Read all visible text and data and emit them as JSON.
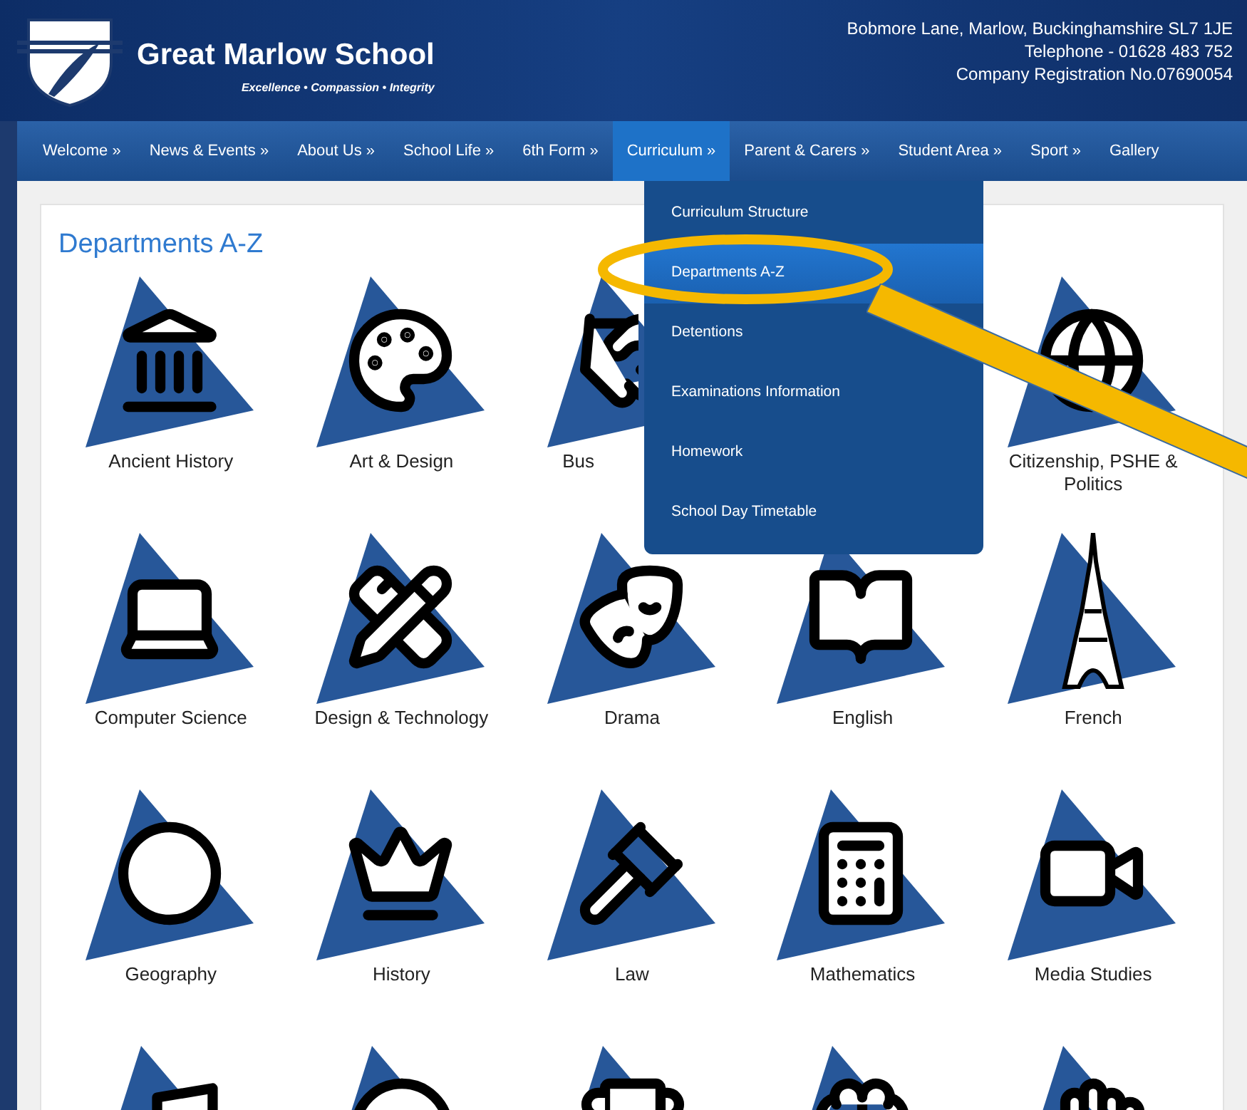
{
  "header": {
    "school_name": "Great Marlow School",
    "tagline": "Excellence • Compassion • Integrity",
    "address": "Bobmore Lane, Marlow, Buckinghamshire SL7 1JE",
    "telephone": "Telephone - 01628 483 752",
    "registration": "Company Registration No.07690054"
  },
  "nav": [
    {
      "label": "Welcome »",
      "selected": false
    },
    {
      "label": "News & Events »",
      "selected": false
    },
    {
      "label": "About Us »",
      "selected": false
    },
    {
      "label": "School Life »",
      "selected": false
    },
    {
      "label": "6th Form »",
      "selected": false
    },
    {
      "label": "Curriculum »",
      "selected": true
    },
    {
      "label": "Parent & Carers »",
      "selected": false
    },
    {
      "label": "Student Area »",
      "selected": false
    },
    {
      "label": "Sport »",
      "selected": false
    },
    {
      "label": "Gallery",
      "selected": false
    }
  ],
  "dropdown": [
    {
      "label": "Curriculum Structure",
      "selected": false
    },
    {
      "label": "Departments A-Z",
      "selected": true
    },
    {
      "label": "Detentions",
      "selected": false
    },
    {
      "label": "Examinations Information",
      "selected": false
    },
    {
      "label": "Homework",
      "selected": false
    },
    {
      "label": "School Day Timetable",
      "selected": false
    }
  ],
  "page_title": "Departments A-Z",
  "departments": [
    {
      "kind": "full",
      "label": "Ancient History"
    },
    {
      "kind": "full",
      "label": "Art & Design"
    },
    {
      "kind": "covered",
      "label": "Bus"
    },
    {
      "kind": "hidden"
    },
    {
      "kind": "full",
      "label": "Citizenship, PSHE & Politics"
    },
    {
      "kind": "full",
      "label": "Computer Science"
    },
    {
      "kind": "full",
      "label": "Design & Technology"
    },
    {
      "kind": "full",
      "label": "Drama"
    },
    {
      "kind": "full",
      "label": "English"
    },
    {
      "kind": "full",
      "label": "French"
    },
    {
      "kind": "full",
      "label": "Geography"
    },
    {
      "kind": "full",
      "label": "History"
    },
    {
      "kind": "full",
      "label": "Law"
    },
    {
      "kind": "full",
      "label": "Mathematics"
    },
    {
      "kind": "full",
      "label": "Media Studies"
    },
    {
      "kind": "cut"
    },
    {
      "kind": "cut"
    },
    {
      "kind": "cut"
    },
    {
      "kind": "cut"
    },
    {
      "kind": "cut"
    }
  ]
}
